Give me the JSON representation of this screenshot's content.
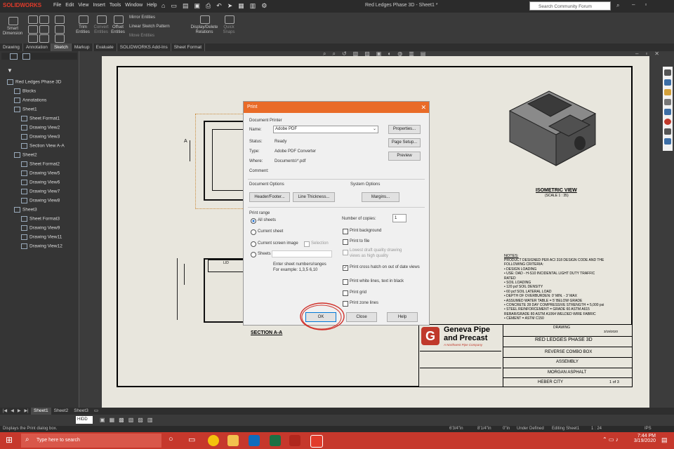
{
  "app": {
    "logo": "SOLIDWORKS",
    "menus": [
      "File",
      "Edit",
      "View",
      "Insert",
      "Tools",
      "Window",
      "Help"
    ],
    "doc_title": "Red Ledges Phase 3D - Sheet1 *",
    "search_placeholder": "Search Community Forum"
  },
  "ribbon": {
    "groups": [
      {
        "label": "Smart Dimension"
      },
      {
        "label": "Trim Entities"
      },
      {
        "label": "Convert Entities"
      },
      {
        "label": "Offset Entities"
      },
      {
        "label": "Mirror Entities"
      },
      {
        "label": "Linear Sketch Pattern"
      },
      {
        "label": "Move Entities"
      },
      {
        "label": "Display/Delete Relations"
      },
      {
        "label": "Quick Snaps"
      }
    ]
  },
  "tabs": [
    "Drawing",
    "Annotation",
    "Sketch",
    "Markup",
    "Evaluate",
    "SOLIDWORKS Add-Ins",
    "Sheet Format"
  ],
  "active_tab": "Sketch",
  "tree": {
    "root": "Red Ledges Phase 3D",
    "items": [
      {
        "label": "Blocks",
        "indent": 1
      },
      {
        "label": "Annotations",
        "indent": 1
      },
      {
        "label": "Sheet1",
        "indent": 1
      },
      {
        "label": "Sheet Format1",
        "indent": 2
      },
      {
        "label": "Drawing View2",
        "indent": 2
      },
      {
        "label": "Drawing View3",
        "indent": 2
      },
      {
        "label": "Section View A-A",
        "indent": 2
      },
      {
        "label": "Sheet2",
        "indent": 1
      },
      {
        "label": "Sheet Format2",
        "indent": 2
      },
      {
        "label": "Drawing View5",
        "indent": 2
      },
      {
        "label": "Drawing View6",
        "indent": 2
      },
      {
        "label": "Drawing View7",
        "indent": 2
      },
      {
        "label": "Drawing View8",
        "indent": 2
      },
      {
        "label": "Sheet3",
        "indent": 1
      },
      {
        "label": "Sheet Format3",
        "indent": 2
      },
      {
        "label": "Drawing View9",
        "indent": 2
      },
      {
        "label": "Drawing View11",
        "indent": 2
      },
      {
        "label": "Drawing View12",
        "indent": 2
      }
    ]
  },
  "drawing": {
    "iso_label": "ISOMETRIC VIEW",
    "iso_scale": "(SCALE 1 : 35)",
    "section_label": "SECTION A-A",
    "notes_title": "NOTES:",
    "notes": [
      "PRODUCT DESIGNED PER ACI 318 DESIGN CODE AND THE",
      "FOLLOWING CRITERIA:",
      "• DESIGN LOADING",
      "  • USE: DAD - H-S10 INCIDENTAL LIGHT DUTY TRAFFIC",
      "    RATED",
      "• SOIL LOADING",
      "  • 120 pcf SOIL DENSITY",
      "  • 60 pcf SOIL LATERAL LOAD",
      "• DEPTH OF OVERBURDEN: 0' MIN. - 3' MAX",
      "• ASSUMED WATER TABLE = 5' BELOW GRADE",
      "• CONCRETE 28 DAY COMPRESSIVE STRENGTH = 5,000 psi",
      "• STEEL REINFORCEMENT = GRADE 60 ASTM A615",
      "  REBAR/GRADE 80 ASTM A1064 WELDED WIRE FABRIC",
      "• CEMENT = ASTM C150"
    ],
    "company_line1": "Geneva Pipe",
    "company_line2": "and Precast",
    "company_tag": "A Northwest Pipe Company",
    "title_project": "RED LEDGES PHASE 3D",
    "title_part": "REVERSE COMBO BOX",
    "title_assembly": "ASSEMBLY",
    "title_client": "MORGAN ASPHALT",
    "title_city": "HEBER CITY",
    "sheet_of": "1 of 3",
    "drawing_label": "DRAWING",
    "date": "3/19/2020"
  },
  "dialog": {
    "title": "Print",
    "document_printer": "Document Printer",
    "name_label": "Name:",
    "name_value": "Adobe PDF",
    "properties": "Properties...",
    "status_label": "Status:",
    "status_value": "Ready",
    "type_label": "Type:",
    "type_value": "Adobe PDF Converter",
    "where_label": "Where:",
    "where_value": "Documents\\*.pdf",
    "comment_label": "Comment:",
    "page_setup": "Page Setup...",
    "preview": "Preview",
    "document_options": "Document Options",
    "header_footer": "Header/Footer...",
    "line_thickness": "Line Thickness...",
    "system_options": "System Options",
    "margins": "Margins...",
    "print_range": "Print range",
    "all_sheets": "All sheets",
    "current_sheet": "Current sheet",
    "current_screen_image": "Current screen image",
    "selection": "Selection",
    "sheets": "Sheets",
    "hint1": "Enter sheet numbers/ranges",
    "hint2": "For example: 1,3,5 6,10",
    "copies_label": "Number of copies:",
    "copies_value": "1",
    "print_background": "Print background",
    "print_to_file": "Print to file",
    "lowest_quality": "Lowest draft quality drawing",
    "lowest_quality2": "views as high quality",
    "print_cross_hatch": "Print cross hatch on out of date views",
    "print_white_lines": "Print white lines, text in black",
    "print_grid": "Print grid",
    "print_zone_lines": "Print zone lines",
    "ok": "OK",
    "close": "Close",
    "help": "Help"
  },
  "sheet_tabs": [
    "Sheet1",
    "Sheet2",
    "Sheet3"
  ],
  "status": {
    "message": "Displays the Print dialog box.",
    "coords": [
      "6'3/4\"in",
      "8'1/4\"in",
      "0\"in"
    ],
    "state": "Under Defined",
    "editing": "Editing Sheet1",
    "scale": "1 : 24",
    "units": "IPS"
  },
  "taskbar": {
    "search_placeholder": "Type here to search",
    "time": "7:44 PM",
    "date": "3/19/2020"
  }
}
